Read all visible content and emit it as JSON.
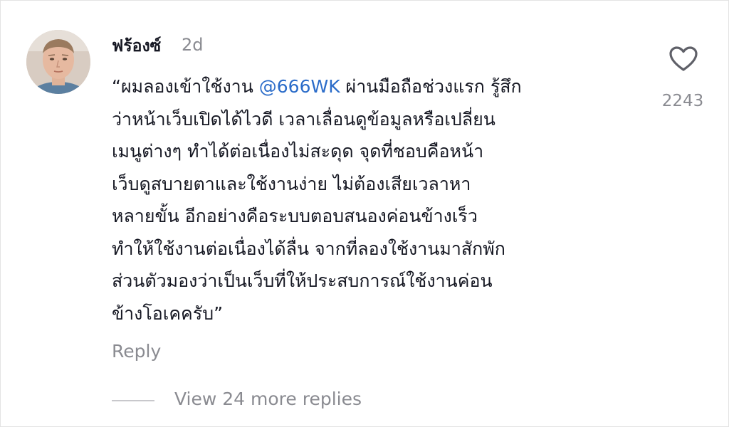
{
  "comment": {
    "author": "ฟร้องซ์",
    "time": "2d",
    "text_prefix": "“ผมลองเข้าใช้งาน ",
    "mention": "@666WK",
    "text_line1_suffix": " ผ่านมือถือช่วงแรก รู้สึก",
    "text_lines": [
      "ว่าหน้าเว็บเปิดได้ไวดี เวลาเลื่อนดูข้อมูลหรือเปลี่ยน",
      "เมนูต่างๆ ทำได้ต่อเนื่องไม่สะดุด จุดที่ชอบคือหน้า",
      "เว็บดูสบายตาและใช้งานง่าย ไม่ต้องเสียเวลาหา",
      "หลายขั้น อีกอย่างคือระบบตอบสนองค่อนข้างเร็ว",
      "ทำให้ใช้งานต่อเนื่องได้ลื่น จากที่ลองใช้งานมาสักพัก",
      "ส่วนตัวมองว่าเป็นเว็บที่ให้ประสบการณ์ใช้งานค่อน",
      "ข้างโอเคครับ”"
    ],
    "like_count": "2243",
    "reply_label": "Reply",
    "view_replies_label": "View 24 more replies"
  },
  "icons": {
    "avatar": "user-avatar",
    "like": "heart-outline-icon"
  },
  "colors": {
    "text": "#161823",
    "muted": "#8a8b91",
    "mention": "#2b6cc9",
    "divider": "#c8c8cc"
  }
}
